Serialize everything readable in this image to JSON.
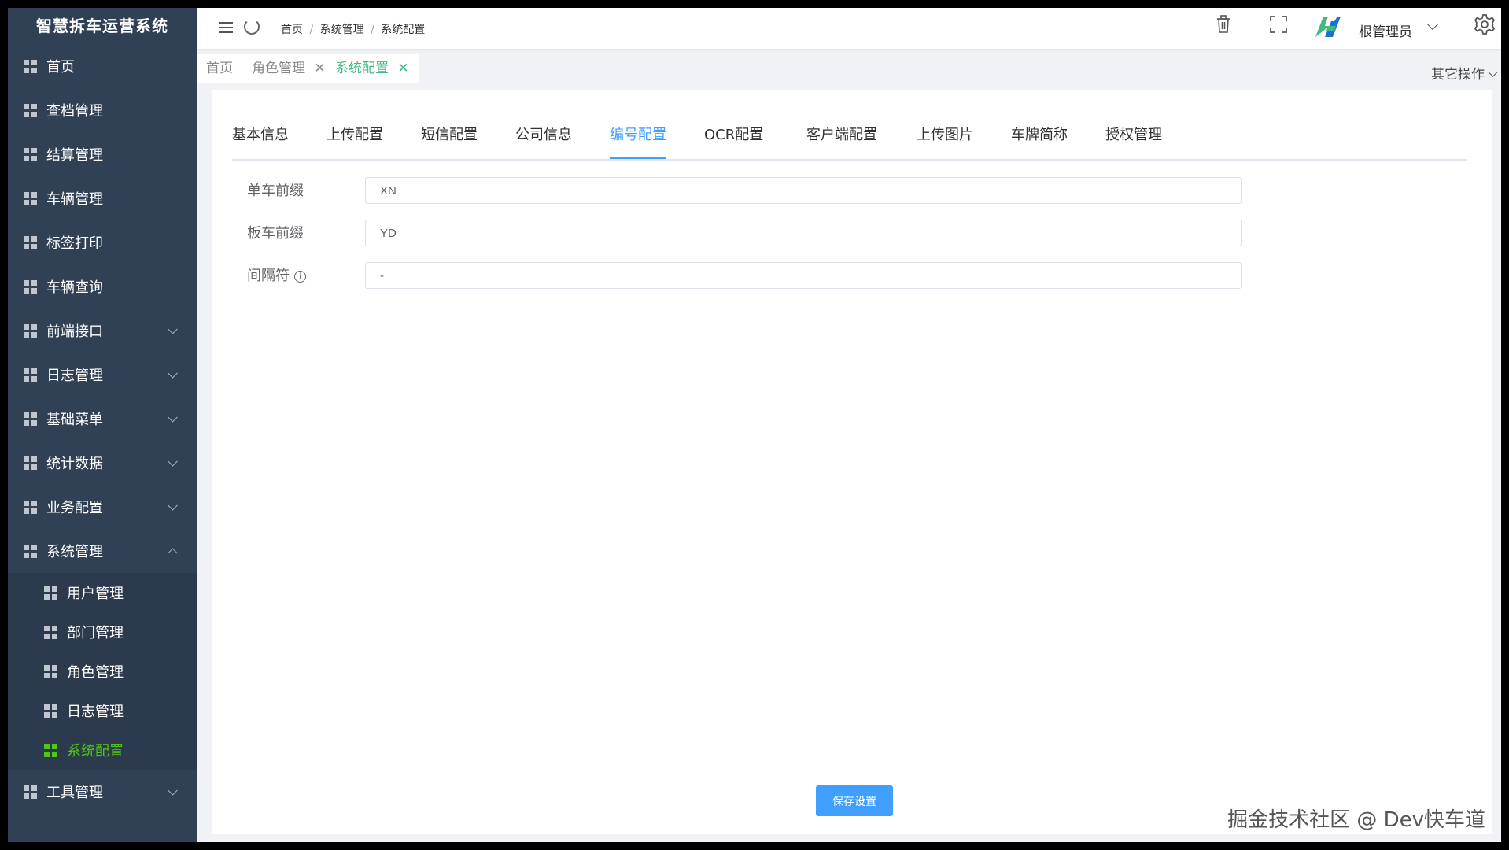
{
  "app": {
    "title": "智慧拆车运营系统"
  },
  "sidebar": {
    "items": [
      {
        "label": "首页"
      },
      {
        "label": "查档管理"
      },
      {
        "label": "结算管理"
      },
      {
        "label": "车辆管理"
      },
      {
        "label": "标签打印"
      },
      {
        "label": "车辆查询"
      },
      {
        "label": "前端接口",
        "expandable": true
      },
      {
        "label": "日志管理",
        "expandable": true
      },
      {
        "label": "基础菜单",
        "expandable": true
      },
      {
        "label": "统计数据",
        "expandable": true
      },
      {
        "label": "业务配置",
        "expandable": true
      },
      {
        "label": "系统管理",
        "expandable": true,
        "expanded": true
      }
    ],
    "submenu": [
      {
        "label": "用户管理"
      },
      {
        "label": "部门管理"
      },
      {
        "label": "角色管理"
      },
      {
        "label": "日志管理"
      },
      {
        "label": "系统配置",
        "active": true
      }
    ],
    "last_item": {
      "label": "工具管理",
      "expandable": true
    },
    "active_color": "#52c41a",
    "background": "#304156"
  },
  "navbar": {
    "breadcrumb": [
      "首页",
      "系统管理",
      "系统配置"
    ],
    "breadcrumb_sep": "/",
    "user_name": "根管理员",
    "icons": [
      "menu-icon",
      "refresh-icon",
      "trash-icon",
      "fullscreen-icon",
      "avatar",
      "gear-icon"
    ]
  },
  "tags": {
    "items": [
      {
        "label": "首页",
        "closable": false
      },
      {
        "label": "角色管理",
        "closable": true
      },
      {
        "label": "系统配置",
        "closable": true,
        "active": true
      }
    ],
    "close_glyph": "✕",
    "other_ops": "其它操作"
  },
  "tabs": {
    "items": [
      "基本信息",
      "上传配置",
      "短信配置",
      "公司信息",
      "编号配置",
      "OCR配置",
      "客户端配置",
      "上传图片",
      "车牌简称",
      "授权管理"
    ],
    "active_index": 4,
    "active_color": "#409eff"
  },
  "form": {
    "fields": [
      {
        "label": "单车前缀",
        "value": "XN"
      },
      {
        "label": "板车前缀",
        "value": "YD"
      },
      {
        "label": "间隔符",
        "value": "-",
        "has_info_icon": true
      }
    ],
    "info_glyph": "i"
  },
  "save_button": {
    "label": "保存设置"
  },
  "watermark": "掘金技术社区 @ Dev快车道"
}
